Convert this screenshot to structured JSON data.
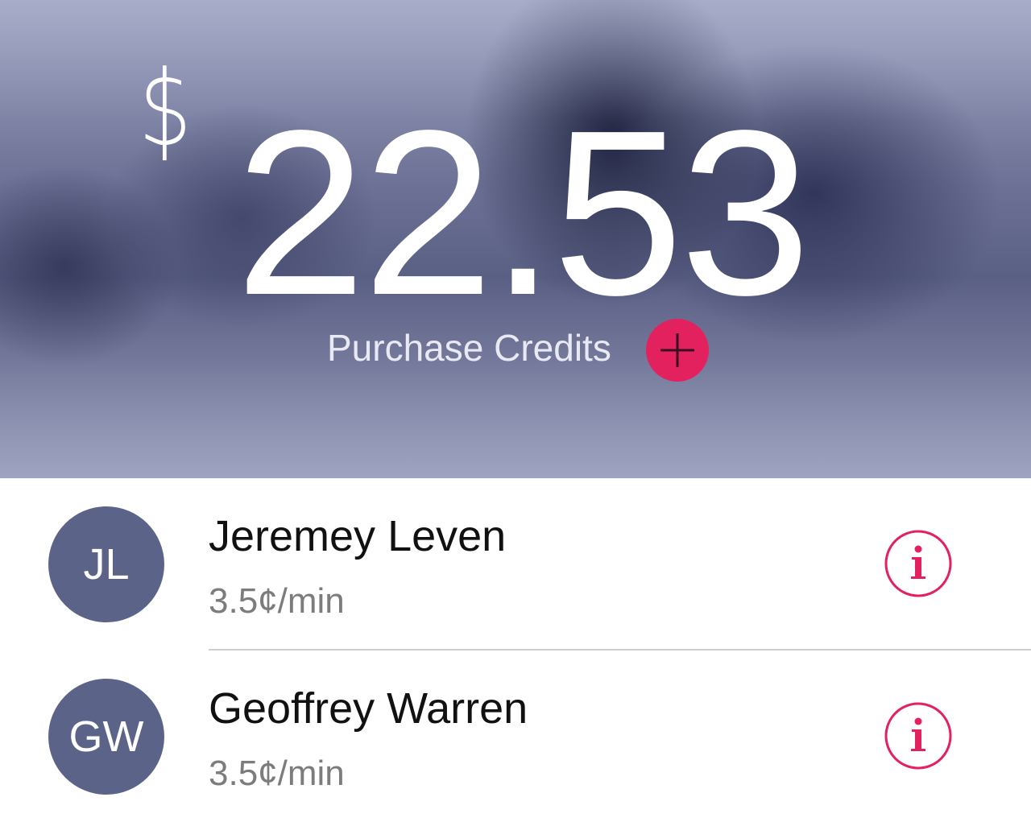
{
  "balance": {
    "currency_symbol": "$",
    "amount": "22.53"
  },
  "purchase": {
    "label": "Purchase Credits",
    "icon": "plus-icon",
    "accent_color": "#e3215f"
  },
  "contacts": [
    {
      "initials": "JL",
      "name": "Jeremey Leven",
      "rate": "3.5¢/min",
      "info_icon": "info-icon"
    },
    {
      "initials": "GW",
      "name": "Geoffrey Warren",
      "rate": "3.5¢/min",
      "info_icon": "info-icon"
    }
  ],
  "colors": {
    "avatar_bg": "#5b6488",
    "accent": "#e3215f",
    "hero_tint": "#5a5f84"
  }
}
